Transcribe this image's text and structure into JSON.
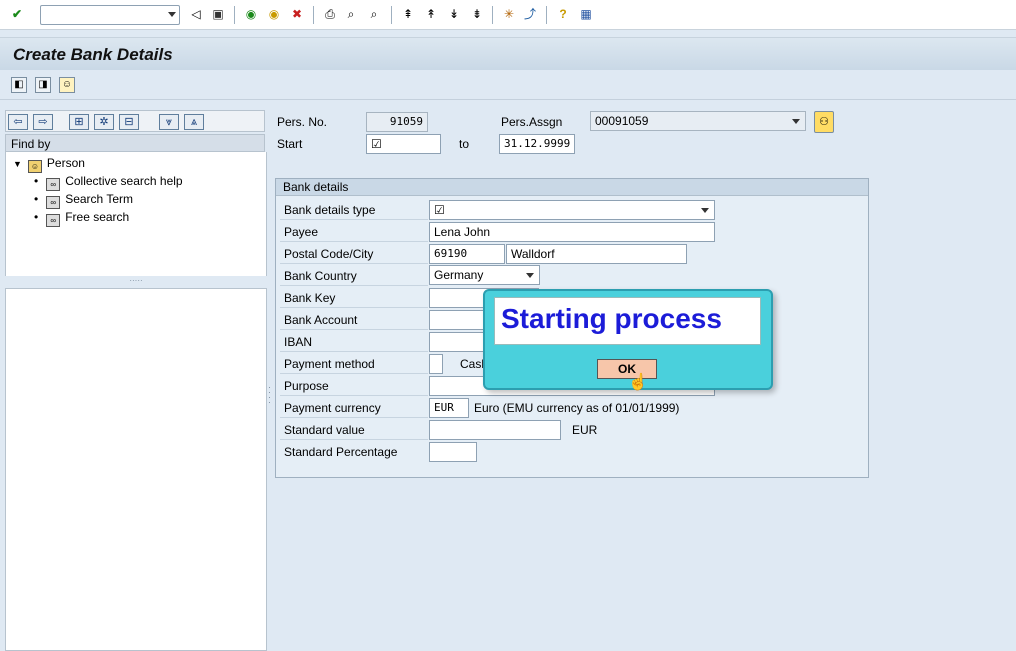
{
  "title": "Create Bank Details",
  "icons": [
    "check-icon",
    "back-icon",
    "save-icon",
    "exit-icon",
    "cancel-icon",
    "print-icon",
    "find-icon",
    "find-next-icon",
    "first-page-icon",
    "prev-page-icon",
    "next-page-icon",
    "last-page-icon",
    "new-session-icon",
    "shortcut-icon",
    "help-icon",
    "layout-icon"
  ],
  "nav": {
    "find_by": "Find by"
  },
  "tree": {
    "root": "Person",
    "items": [
      "Collective search help",
      "Search Term",
      "Free search"
    ]
  },
  "header": {
    "pers_no_label": "Pers. No.",
    "pers_no_value": "91059",
    "pers_assgn_label": "Pers.Assgn",
    "pers_assgn_value": "00091059",
    "start_label": "Start",
    "start_value": "☑",
    "to_label": "to",
    "to_value": "31.12.9999"
  },
  "bank": {
    "group_title": "Bank details",
    "type_label": "Bank details type",
    "type_value": "☑",
    "payee_label": "Payee",
    "payee_value": "Lena John",
    "postal_label": "Postal Code/City",
    "postal_value": "69190",
    "city_value": "Walldorf",
    "country_label": "Bank Country",
    "country_value": "Germany",
    "key_label": "Bank Key",
    "account_label": "Bank Account",
    "iban_label": "IBAN",
    "payment_label": "Payment method",
    "payment_text": "Cash",
    "purpose_label": "Purpose",
    "currency_label": "Payment currency",
    "currency_value": "EUR",
    "currency_text": "Euro (EMU currency as of 01/01/1999)",
    "std_value_label": "Standard value",
    "std_value_unit": "EUR",
    "std_pct_label": "Standard Percentage"
  },
  "popup": {
    "message": "Starting process",
    "ok_label": "OK"
  }
}
